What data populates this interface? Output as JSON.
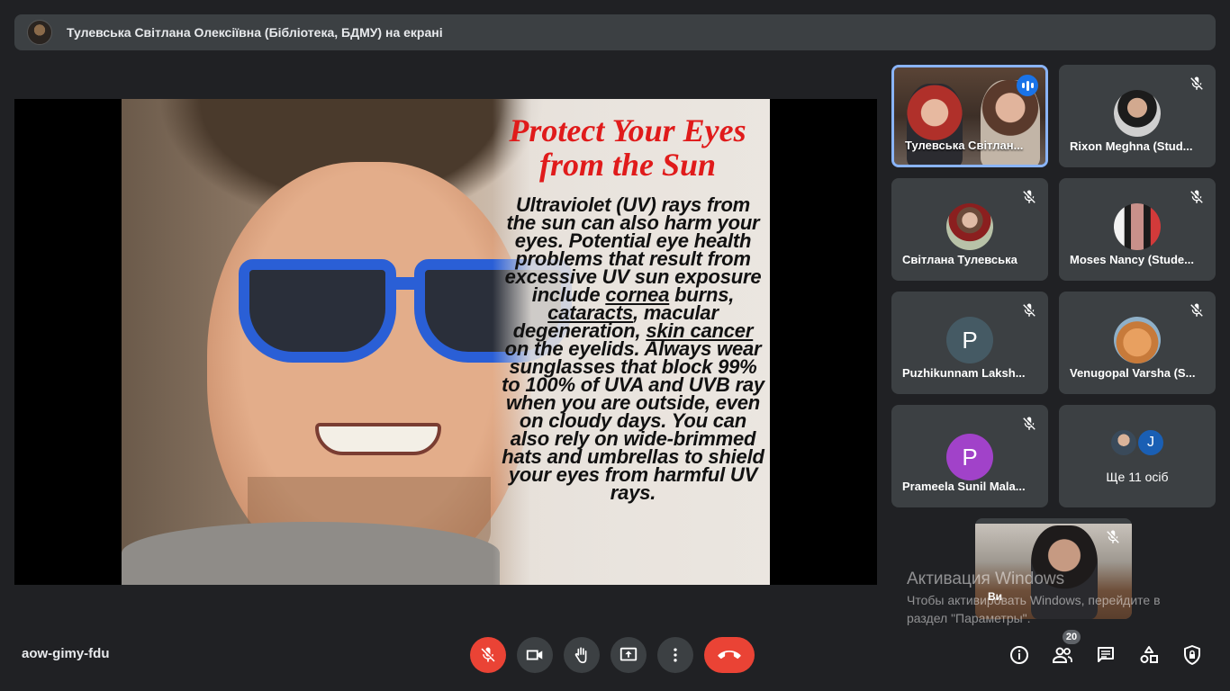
{
  "banner": {
    "presenter_text": "Тулевська Світлана Олексіївна (Бібліотека, БДМУ) на екрані"
  },
  "slide": {
    "title": "Protect Your Eyes from the Sun",
    "body": [
      {
        "text": "Ultraviolet (UV) rays from the sun can also harm your eyes. Potential eye health problems that result from excessive UV sun exposure include "
      },
      {
        "text": "cornea",
        "underline": true
      },
      {
        "text": " burns, "
      },
      {
        "text": "cataracts",
        "underline": true
      },
      {
        "text": ", macular degeneration, "
      },
      {
        "text": "skin cancer",
        "underline": true
      },
      {
        "text": " on the eyelids. Always wear sunglasses that block 99% to 100% of UVA and UVB ray when you are outside, even on cloudy days. You can also rely on wide-brimmed hats and umbrellas to shield your eyes from harmful UV rays."
      }
    ]
  },
  "participants": [
    {
      "name": "Тулевська Світлан...",
      "type": "video",
      "speaking": true
    },
    {
      "name": "Rixon Meghna (Stud...",
      "type": "photo",
      "muted": true
    },
    {
      "name": "Світлана Тулевська",
      "type": "photo",
      "muted": true
    },
    {
      "name": "Moses Nancy (Stude...",
      "type": "photo",
      "muted": true
    },
    {
      "name": "Puzhikunnam Laksh...",
      "type": "letter",
      "letter": "P",
      "color": "#455a64",
      "muted": true
    },
    {
      "name": "Venugopal Varsha (S...",
      "type": "photo",
      "muted": true
    },
    {
      "name": "Prameela Sunil Mala...",
      "type": "letter",
      "letter": "P",
      "color": "#a142c9",
      "muted": true
    }
  ],
  "more_tile": {
    "label": "Ще 11 осіб",
    "letter": "J"
  },
  "self_view": {
    "name": "Ви",
    "muted": true
  },
  "watermark": {
    "line1": "Активация Windows",
    "line2": "Чтобы активировать Windows, перейдите в раздел \"Параметры\"."
  },
  "meeting": {
    "code": "aow-gimy-fdu",
    "people_count": "20"
  },
  "controls": [
    {
      "name": "mic-off-icon"
    },
    {
      "name": "camera-icon"
    },
    {
      "name": "raise-hand-icon"
    },
    {
      "name": "present-icon"
    },
    {
      "name": "more-options-icon"
    },
    {
      "name": "end-call-icon"
    }
  ],
  "colors": {
    "background": "#202124",
    "tile": "#3c4043",
    "danger": "#ea4335",
    "active_border": "#8ab4f8",
    "speaking_blue": "#1a73e8",
    "slide_title": "#e01b1b"
  }
}
